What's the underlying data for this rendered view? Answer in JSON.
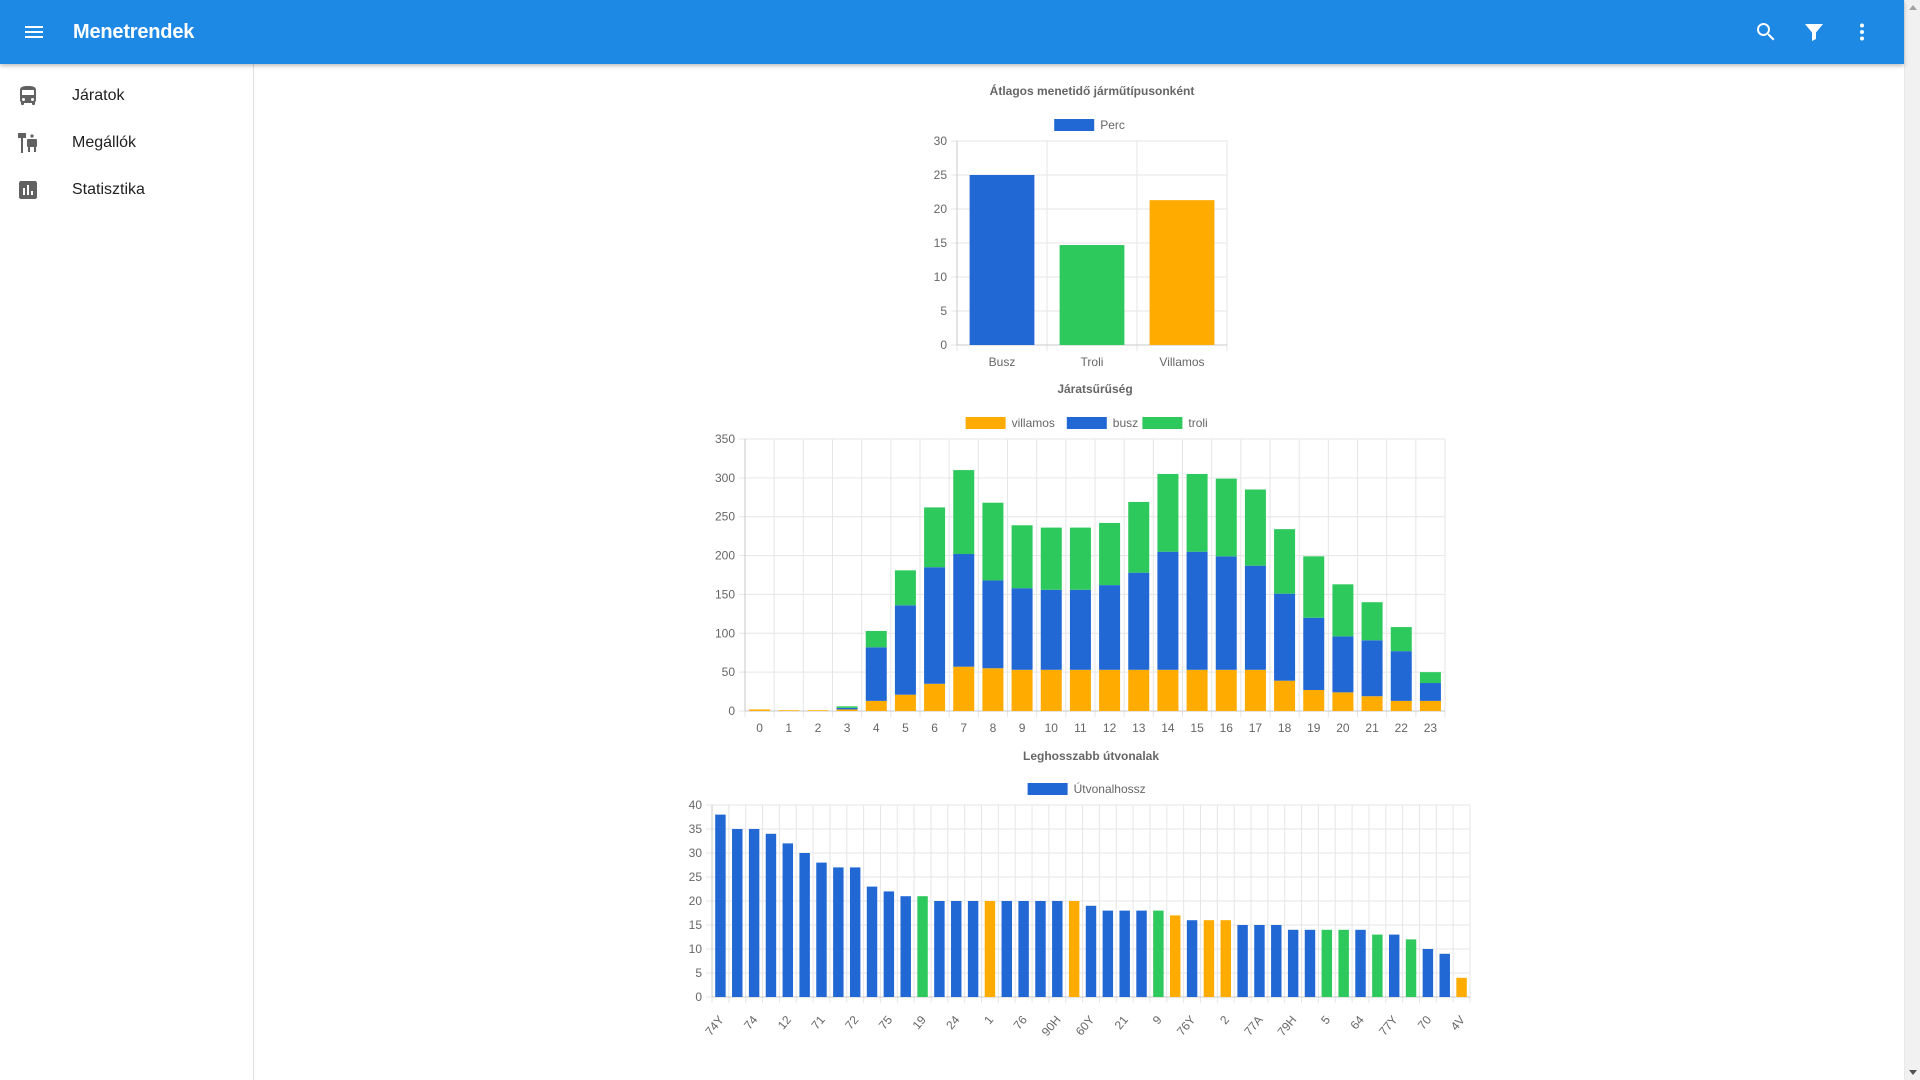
{
  "app": {
    "title": "Menetrendek"
  },
  "header_actions": [
    "search-icon",
    "filter-icon",
    "more-vert-icon"
  ],
  "colors": {
    "primary": "#1e88e5",
    "busz": "#2268d4",
    "troli": "#2ec95c",
    "villamos": "#ffab00"
  },
  "sidebar": {
    "items": [
      {
        "label": "Járatok",
        "icon": "bus-icon"
      },
      {
        "label": "Megállók",
        "icon": "bus-stop-icon"
      },
      {
        "label": "Statisztika",
        "icon": "bar-chart-icon"
      }
    ]
  },
  "chart_data": [
    {
      "type": "bar",
      "title": "Átlagos menetidő járműtípusonként",
      "categories": [
        "Busz",
        "Troli",
        "Villamos"
      ],
      "series": [
        {
          "name": "Perc",
          "values": [
            25,
            14.7,
            21.3
          ]
        }
      ],
      "bar_colors": [
        "#2268d4",
        "#2ec95c",
        "#ffab00"
      ],
      "ylim": [
        0,
        30
      ],
      "yticks": [
        0,
        5,
        10,
        15,
        20,
        25,
        30
      ],
      "grid": true,
      "legend": "top"
    },
    {
      "type": "bar",
      "stacked": true,
      "title": "Járatsűrűség",
      "categories": [
        "0",
        "1",
        "2",
        "3",
        "4",
        "5",
        "6",
        "7",
        "8",
        "9",
        "10",
        "11",
        "12",
        "13",
        "14",
        "15",
        "16",
        "17",
        "18",
        "19",
        "20",
        "21",
        "22",
        "23"
      ],
      "series": [
        {
          "name": "villamos",
          "color": "#ffab00",
          "values": [
            2,
            1,
            1,
            2,
            13,
            21,
            35,
            57,
            55,
            53,
            53,
            53,
            53,
            53,
            53,
            53,
            53,
            53,
            39,
            27,
            24,
            19,
            13,
            13
          ]
        },
        {
          "name": "busz",
          "color": "#2268d4",
          "values": [
            0,
            0,
            0,
            2,
            69,
            115,
            150,
            145,
            113,
            105,
            103,
            103,
            109,
            125,
            152,
            152,
            146,
            134,
            112,
            93,
            72,
            72,
            64,
            23
          ]
        },
        {
          "name": "troli",
          "color": "#2ec95c",
          "values": [
            0,
            0,
            0,
            2,
            21,
            45,
            77,
            108,
            100,
            81,
            80,
            80,
            80,
            91,
            100,
            100,
            100,
            98,
            83,
            79,
            67,
            49,
            31,
            14
          ]
        }
      ],
      "ylim": [
        0,
        350
      ],
      "yticks": [
        0,
        50,
        100,
        150,
        200,
        250,
        300,
        350
      ],
      "grid": true,
      "legend": "top"
    },
    {
      "type": "bar",
      "title": "Leghosszabb útvonalak",
      "categories": [
        "74Y",
        "74",
        "12",
        "71",
        "72",
        "75",
        "19",
        "24",
        "1",
        "76",
        "90H",
        "60Y",
        "21",
        "9",
        "76Y",
        "2",
        "77A",
        "79H",
        "5",
        "64",
        "77Y",
        "70",
        "4V"
      ],
      "tick_labels": [
        "74Y",
        "74",
        "12",
        "71",
        "72",
        "75",
        "19",
        "24",
        "1",
        "76",
        "90H",
        "60Y",
        "21",
        "9",
        "76Y",
        "2",
        "77A",
        "79H",
        "5",
        "64",
        "77Y",
        "70",
        "4V"
      ],
      "series": [
        {
          "name": "Útvonalhossz",
          "values": [
            38,
            35,
            35,
            34,
            32,
            30,
            28,
            27,
            27,
            23,
            22,
            21,
            21,
            20,
            20,
            20,
            20,
            20,
            20,
            20,
            20,
            20,
            19,
            18,
            18,
            18,
            18,
            17,
            16,
            16,
            16,
            15,
            15,
            15,
            14,
            14,
            14,
            14,
            14,
            13,
            13,
            12,
            10,
            9,
            4
          ]
        }
      ],
      "bar_types": [
        "b",
        "b",
        "b",
        "b",
        "b",
        "b",
        "b",
        "b",
        "b",
        "b",
        "b",
        "b",
        "t",
        "b",
        "b",
        "b",
        "v",
        "b",
        "b",
        "b",
        "b",
        "v",
        "b",
        "b",
        "b",
        "b",
        "t",
        "v",
        "b",
        "v",
        "v",
        "b",
        "b",
        "b",
        "b",
        "b",
        "t",
        "t",
        "b",
        "t",
        "b",
        "t",
        "b",
        "b",
        "v"
      ],
      "ylim": [
        0,
        40
      ],
      "yticks": [
        0,
        5,
        10,
        15,
        20,
        25,
        30,
        35,
        40
      ],
      "grid": true,
      "legend": "top"
    }
  ]
}
